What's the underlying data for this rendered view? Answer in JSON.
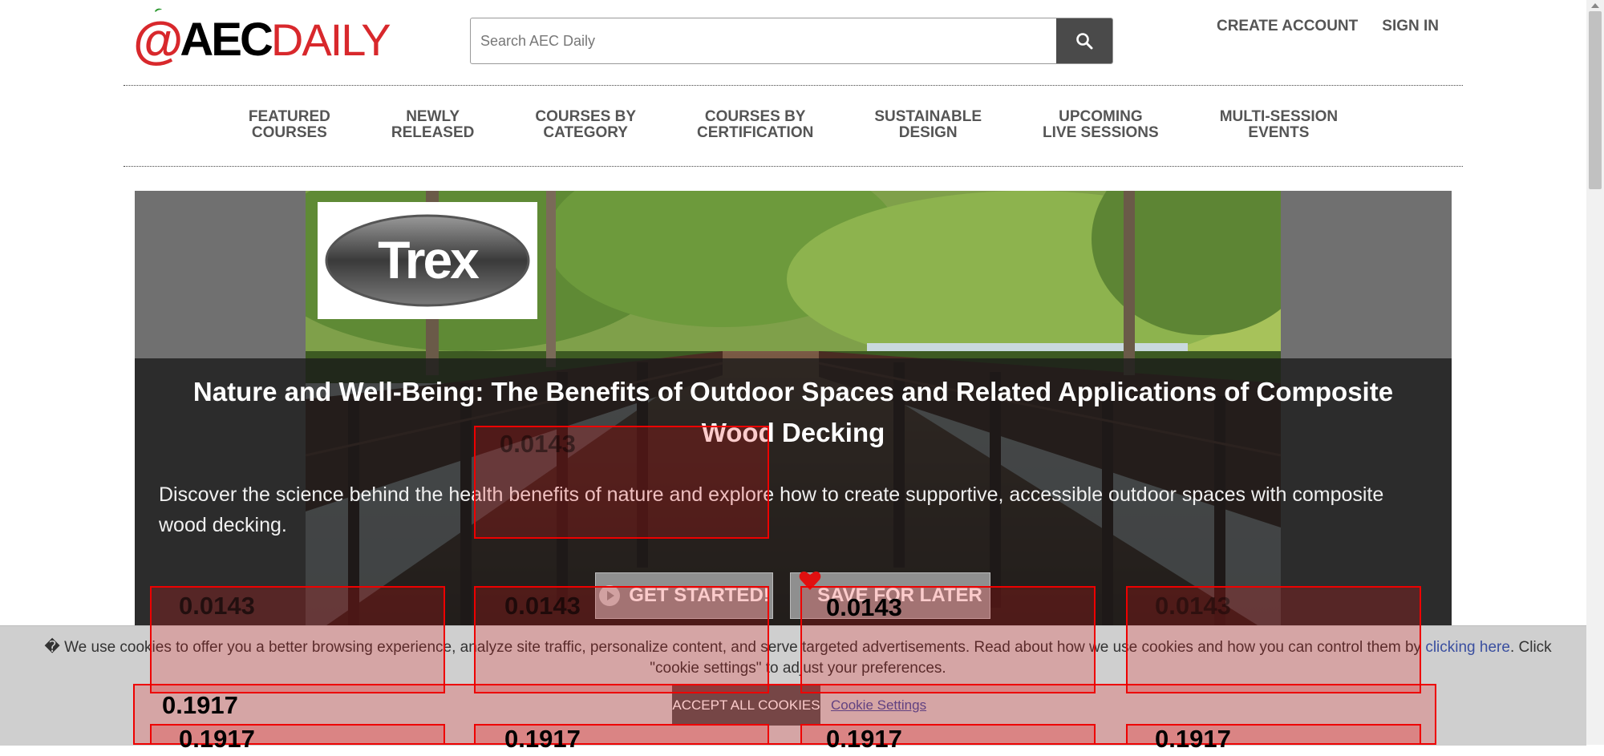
{
  "brand": {
    "logo_at": "@",
    "logo_aec": "AEC",
    "logo_daily": "DAILY",
    "accent": "#d8282c"
  },
  "search": {
    "placeholder": "Search AEC Daily",
    "icon": "search-icon"
  },
  "account_links": {
    "create": "CREATE ACCOUNT",
    "signin": "SIGN IN"
  },
  "nav": {
    "items": [
      {
        "label": "FEATURED\nCOURSES"
      },
      {
        "label": "NEWLY\nRELEASED"
      },
      {
        "label": "COURSES BY\nCATEGORY"
      },
      {
        "label": "COURSES BY\nCERTIFICATION"
      },
      {
        "label": "SUSTAINABLE\nDESIGN"
      },
      {
        "label": "UPCOMING\nLIVE SESSIONS"
      },
      {
        "label": "MULTI-SESSION\nEVENTS"
      }
    ]
  },
  "hero": {
    "sponsor_logo_text": "Trex",
    "title": "Nature and Well-Being: The Benefits of Outdoor Spaces and Related Applications of Composite Wood Decking",
    "description": "Discover the science behind the health benefits of nature and explore how to create supportive, accessible outdoor spaces with composite wood decking.",
    "start_label": "GET STARTED!",
    "save_label": "SAVE FOR LATER"
  },
  "cookie": {
    "text_before": " We use cookies to offer you a better browsing experience, analyze site traffic, personalize content, and serve targeted advertisements. Read about how we use cookies and how you can control them by ",
    "link_text": "clicking here",
    "text_after": ". Click \"cookie settings\" to adjust your preferences.",
    "accept_label": "ACCEPT ALL COOKIES",
    "settings_label": "Cookie Settings"
  },
  "overlays": {
    "v1": "0.0143",
    "v2": "0.1917"
  },
  "colors": {
    "nav_text": "#555555",
    "hero_band": "#1a1a1a",
    "overlay_red": "#ee0000",
    "link": "#3a4fa0"
  }
}
